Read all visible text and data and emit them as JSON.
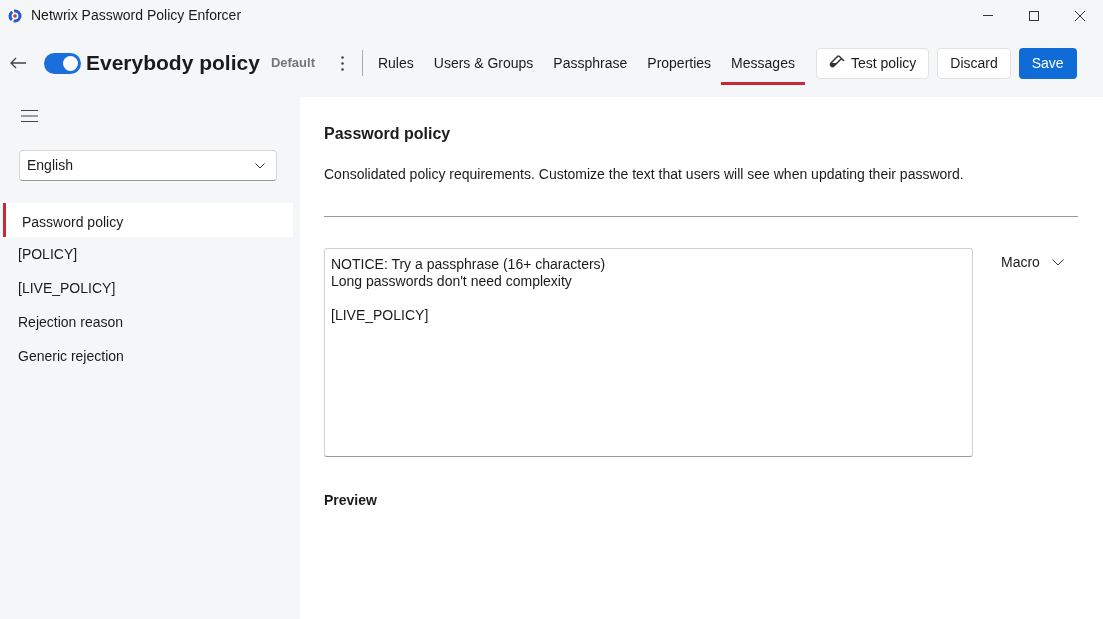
{
  "window": {
    "title": "Netwrix Password Policy Enforcer"
  },
  "header": {
    "enabled": true,
    "policy_name": "Everybody policy",
    "badge": "Default",
    "tabs": [
      {
        "label": "Rules",
        "selected": false
      },
      {
        "label": "Users & Groups",
        "selected": false
      },
      {
        "label": "Passphrase",
        "selected": false
      },
      {
        "label": "Properties",
        "selected": false
      },
      {
        "label": "Messages",
        "selected": true
      }
    ],
    "buttons": [
      {
        "label": "Test policy",
        "kind": "test"
      },
      {
        "label": "Discard",
        "kind": "plain"
      },
      {
        "label": "Save",
        "kind": "primary"
      }
    ]
  },
  "sidebar": {
    "language": "English",
    "items": [
      {
        "label": "Password policy",
        "selected": true
      },
      {
        "label": "[POLICY]",
        "selected": false
      },
      {
        "label": "[LIVE_POLICY]",
        "selected": false
      },
      {
        "label": "Rejection reason",
        "selected": false
      },
      {
        "label": "Generic rejection",
        "selected": false
      }
    ]
  },
  "content": {
    "title": "Password policy",
    "description": "Consolidated policy requirements. Customize the text that users will see when updating their password.",
    "message": "NOTICE: Try a passphrase (16+ characters)\nLong passwords don't need complexity\n\n[LIVE_POLICY]",
    "macro_label": "Macro",
    "preview_title": "Preview"
  }
}
